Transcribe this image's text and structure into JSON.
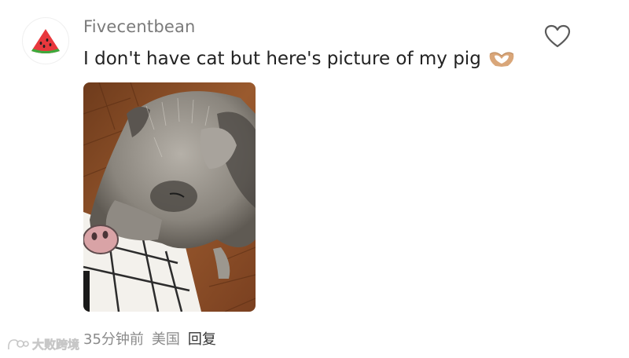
{
  "comment": {
    "username": "Fivecentbean",
    "text": "I don't have cat but here's picture of my pig",
    "emoji_icon": "heart-hands-icon",
    "avatar_icon": "watermelon-icon",
    "like_icon": "heart-outline-icon",
    "image_subject": "pig-photo",
    "meta": {
      "time": "35分钟前",
      "location": "美国",
      "reply_label": "回复"
    }
  },
  "watermark": {
    "text": "大败跨境"
  },
  "colors": {
    "username": "#7a7a7a",
    "body_text": "#222222",
    "meta": "#8a8a8a",
    "reply": "#333333",
    "watermelon_flesh": "#e8383d",
    "watermelon_rind": "#3caa3c"
  }
}
